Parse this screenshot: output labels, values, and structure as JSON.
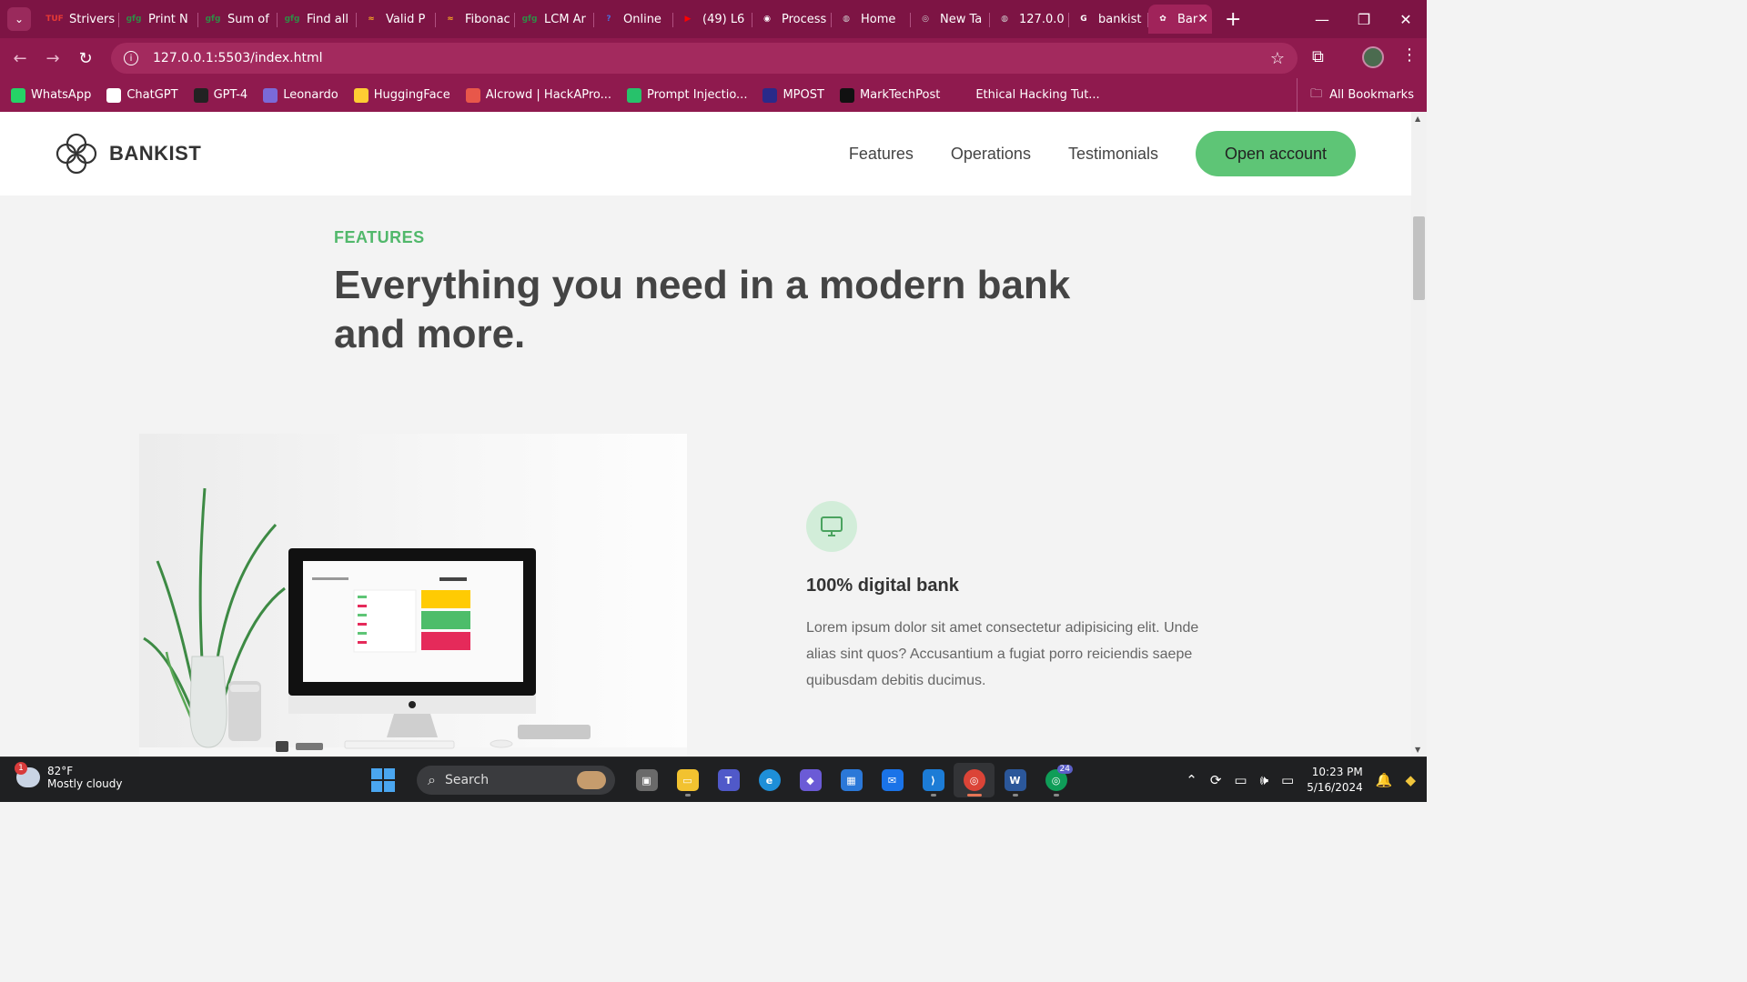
{
  "browser": {
    "tabs": [
      {
        "title": "Strivers",
        "icon": "tuf-icon",
        "color": "#e53935",
        "short": "TUF"
      },
      {
        "title": "Print N",
        "icon": "gfg-icon",
        "color": "#2f8d46",
        "short": "gfg"
      },
      {
        "title": "Sum of",
        "icon": "gfg-icon",
        "color": "#2f8d46",
        "short": "gfg"
      },
      {
        "title": "Find all",
        "icon": "gfg-icon",
        "color": "#2f8d46",
        "short": "gfg"
      },
      {
        "title": "Valid P",
        "icon": "codestudio-icon",
        "color": "#f5a623",
        "short": "≈"
      },
      {
        "title": "Fibonac",
        "icon": "codestudio-icon",
        "color": "#f5a623",
        "short": "≈"
      },
      {
        "title": "LCM Ar",
        "icon": "gfg-icon",
        "color": "#2f8d46",
        "short": "gfg"
      },
      {
        "title": "Online",
        "icon": "online-icon",
        "color": "#4b6bd8",
        "short": "?"
      },
      {
        "title": "(49) L6",
        "icon": "youtube-icon",
        "color": "#ff0000",
        "short": "▶"
      },
      {
        "title": "Process",
        "icon": "github-icon",
        "color": "#ffffff",
        "short": "◉"
      },
      {
        "title": "Home",
        "icon": "globe-icon",
        "color": "#d0d0d0",
        "short": "◍"
      },
      {
        "title": "New Ta",
        "icon": "chrome-icon",
        "color": "#d0d0d0",
        "short": "◎"
      },
      {
        "title": "127.0.0",
        "icon": "globe-icon",
        "color": "#d0d0d0",
        "short": "◍"
      },
      {
        "title": "bankist",
        "icon": "google-icon",
        "color": "#ffffff",
        "short": "G"
      }
    ],
    "active_tab": {
      "title": "Bar",
      "icon": "bankist-icon"
    },
    "url": "127.0.0.1:5503/index.html",
    "bookmarks": [
      {
        "label": "WhatsApp",
        "icon": "whatsapp-icon",
        "color": "#25d366"
      },
      {
        "label": "ChatGPT",
        "icon": "chatgpt-icon",
        "color": "#ffffff"
      },
      {
        "label": "GPT-4",
        "icon": "gpt4-icon",
        "color": "#222222"
      },
      {
        "label": "Leonardo",
        "icon": "leonardo-icon",
        "color": "#7a6ad8"
      },
      {
        "label": "HuggingFace",
        "icon": "huggingface-icon",
        "color": "#ffcc33"
      },
      {
        "label": "Alcrowd | HackAPro...",
        "icon": "aicrowd-icon",
        "color": "#e8574a"
      },
      {
        "label": "Prompt Injectio...",
        "icon": "prompt-icon",
        "color": "#27c26b"
      },
      {
        "label": "MPOST",
        "icon": "mpost-icon",
        "color": "#2a2a8a"
      },
      {
        "label": "MarkTechPost",
        "icon": "marktechpost-icon",
        "color": "#111111"
      },
      {
        "label": "Ethical Hacking Tut...",
        "icon": "",
        "color": ""
      }
    ],
    "all_bookmarks": "All Bookmarks"
  },
  "site": {
    "logo_text": "BANKIST",
    "nav": {
      "features": "Features",
      "operations": "Operations",
      "testimonials": "Testimonials",
      "open_account": "Open account"
    },
    "section_tag": "FEATURES",
    "section_title": "Everything you need in a modern bank and more.",
    "feature": {
      "title": "100% digital bank",
      "text": "Lorem ipsum dolor sit amet consectetur adipisicing elit. Unde alias sint quos? Accusantium a fugiat porro reiciendis saepe quibusdam debitis ducimus."
    },
    "accent": "#5ec576"
  },
  "taskbar": {
    "weather_temp": "82°F",
    "weather_desc": "Mostly cloudy",
    "weather_badge": "1",
    "search": "Search",
    "time": "10:23 PM",
    "date": "5/16/2024",
    "chrome_badge": "24"
  }
}
